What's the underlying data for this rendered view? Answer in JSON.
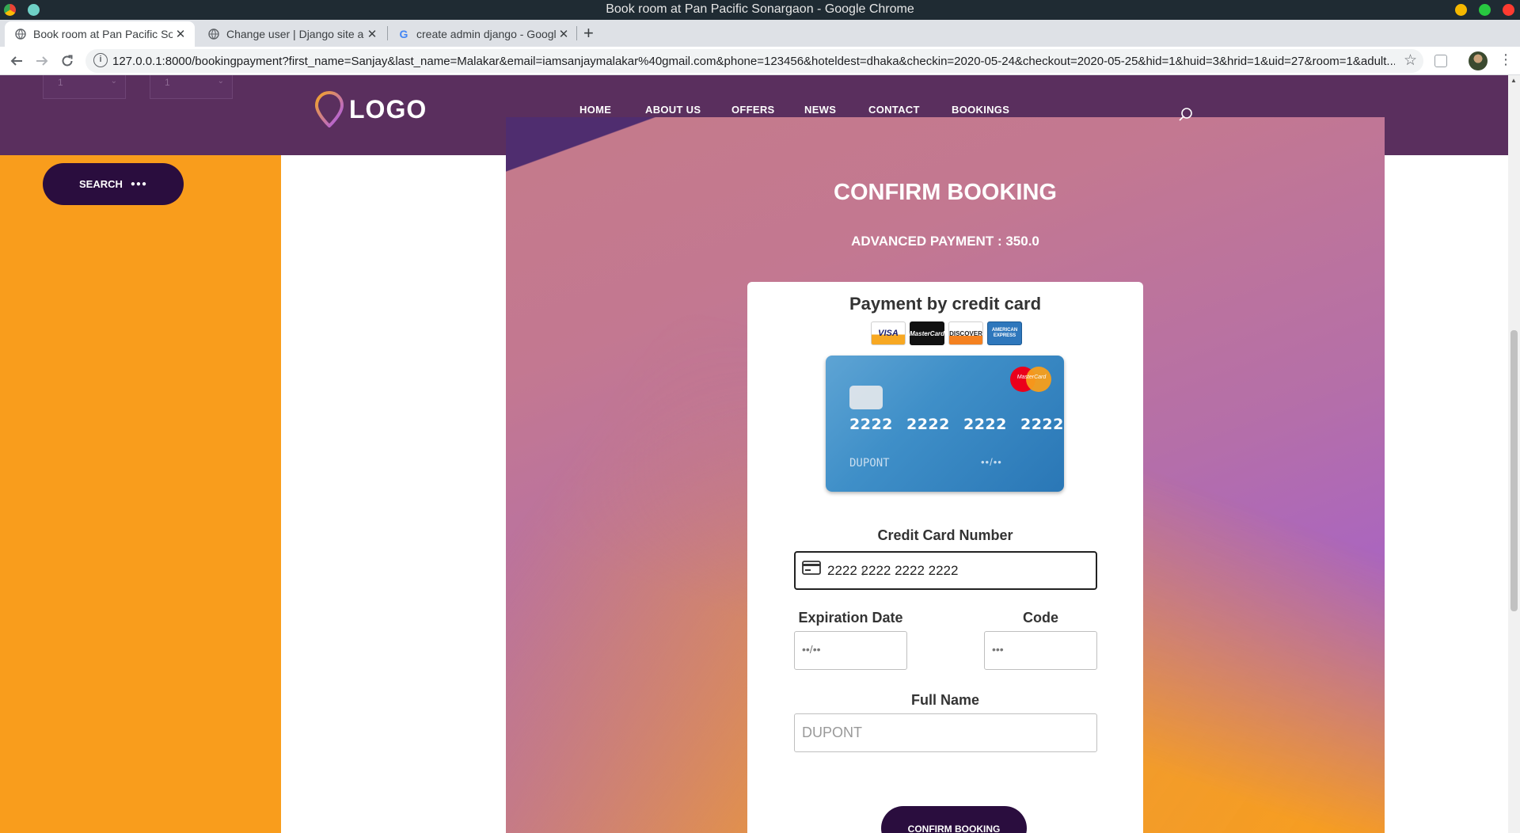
{
  "window": {
    "title": "Book room at Pan Pacific Sonargaon - Google Chrome"
  },
  "tabs": [
    {
      "label": "Book room at Pan Pacific Sonargaon",
      "active": true
    },
    {
      "label": "Change user | Django site admin",
      "active": false
    },
    {
      "label": "create admin django - Google Search",
      "active": false
    }
  ],
  "toolbar": {
    "url": "127.0.0.1:8000/bookingpayment?first_name=Sanjay&last_name=Malakar&email=iamsanjaymalakar%40gmail.com&phone=123456&hoteldest=dhaka&checkin=2020-05-24&checkout=2020-05-25&hid=1&huid=3&hrid=1&uid=27&room=1&adult..."
  },
  "sidebar": {
    "select_1_value": "1",
    "select_2_value": "1",
    "search_label": "SEARCH",
    "search_dots": "●●●"
  },
  "header": {
    "logo_text": "LOGO",
    "nav": [
      "HOME",
      "ABOUT US",
      "OFFERS",
      "NEWS",
      "CONTACT",
      "BOOKINGS"
    ]
  },
  "booking": {
    "title": "CONFIRM BOOKING",
    "advanced_payment": "ADVANCED PAYMENT : 350.0"
  },
  "payment_form": {
    "title": "Payment by credit card",
    "brands": [
      "VISA",
      "MasterCard",
      "DISCOVER",
      "AMERICAN EXPRESS"
    ],
    "card_preview": {
      "brand": "MasterCard",
      "number": "2222 2222 2222 2222",
      "name": "DUPONT",
      "expiry": "••/••"
    },
    "card_number_label": "Credit Card Number",
    "card_number_value": "2222 2222 2222 2222",
    "expiration_label": "Expiration Date",
    "expiration_placeholder": "••/••",
    "code_label": "Code",
    "code_placeholder": "•••",
    "full_name_label": "Full Name",
    "full_name_placeholder": "DUPONT",
    "confirm_label": "CONFIRM BOOKING"
  },
  "colors": {
    "header_purple": "#5a2f5e",
    "sidebar_orange": "#f99d1c",
    "button_dark": "#2a0d3e"
  }
}
